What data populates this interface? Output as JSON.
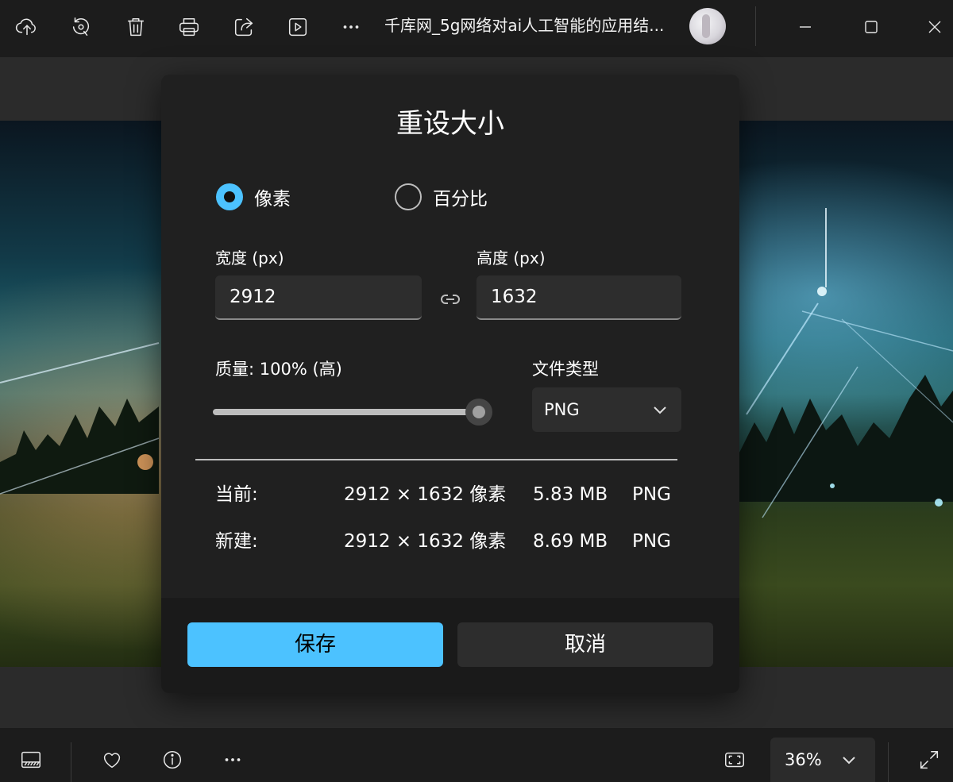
{
  "toolbar": {
    "title": "千库网_5g网络对ai人工智能的应用结..."
  },
  "dialog": {
    "title": "重设大小",
    "mode_pixels_label": "像素",
    "mode_percent_label": "百分比",
    "selected_mode": "像素",
    "width_label": "宽度 (px)",
    "width_value": "2912",
    "height_label": "高度 (px)",
    "height_value": "1632",
    "quality_label": "质量: 100% (高)",
    "quality_percent": 100,
    "filetype_label": "文件类型",
    "filetype_value": "PNG",
    "current": {
      "label": "当前:",
      "dimensions": "2912 × 1632 像素",
      "size": "5.83 MB",
      "format": "PNG"
    },
    "new": {
      "label": "新建:",
      "dimensions": "2912 × 1632 像素",
      "size": "8.69 MB",
      "format": "PNG"
    },
    "save_label": "保存",
    "cancel_label": "取消"
  },
  "bottombar": {
    "zoom_value": "36%"
  },
  "colors": {
    "accent": "#4cc2ff",
    "background": "#1c1c1c",
    "dialog": "#202020",
    "input": "#2d2d2d"
  },
  "icons": {
    "toolbar": [
      "cloud-upload-icon",
      "rotate-icon",
      "delete-icon",
      "print-icon",
      "share-icon",
      "slideshow-icon",
      "more-icon"
    ],
    "window": [
      "minimize-icon",
      "maximize-icon",
      "close-icon"
    ],
    "bottom": [
      "filmstrip-icon",
      "heart-icon",
      "info-icon",
      "more-icon",
      "fit-screen-icon",
      "chevron-down-icon",
      "fullscreen-icon"
    ]
  }
}
